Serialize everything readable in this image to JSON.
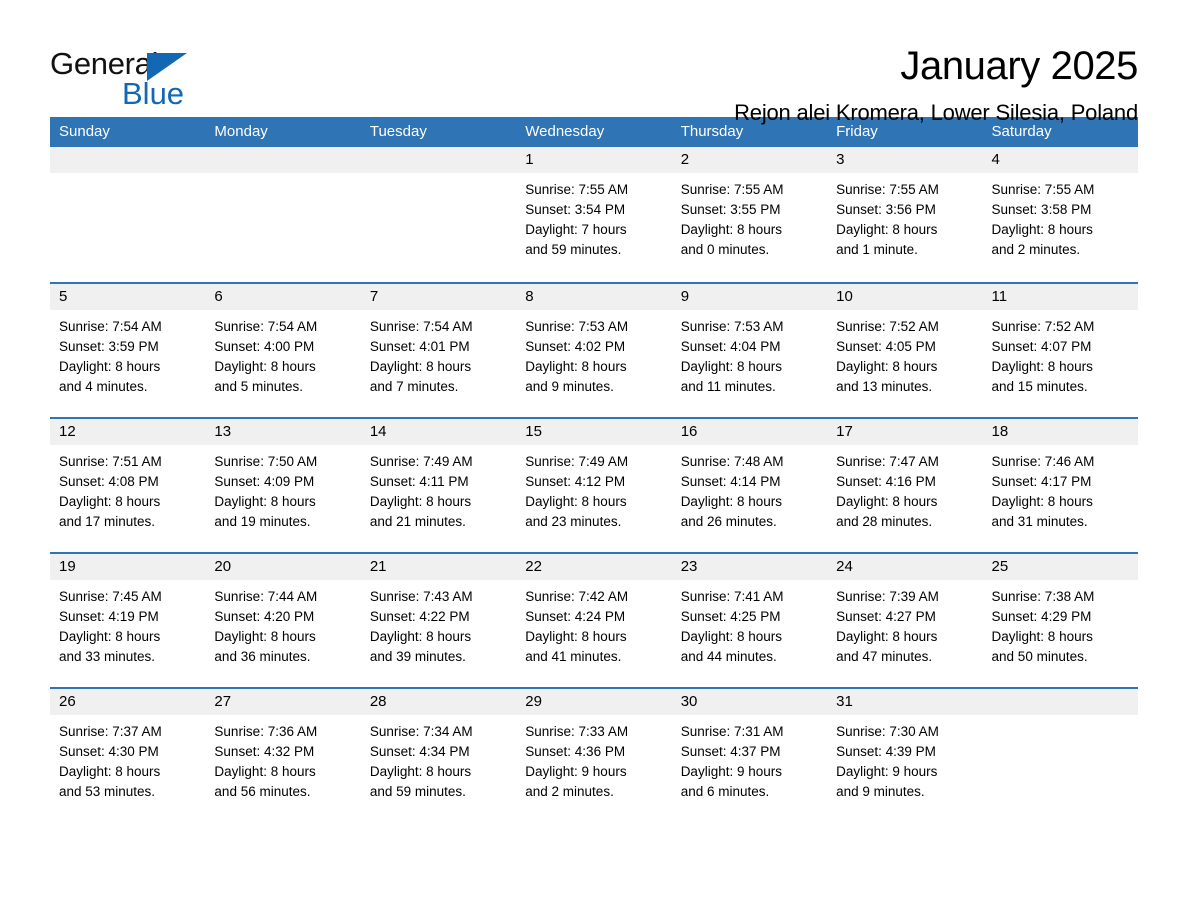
{
  "brand": {
    "name_part1": "General",
    "name_part2": "Blue",
    "triangle_color": "#1268b3"
  },
  "header": {
    "title": "January 2025",
    "subtitle": "Rejon alei Kromera, Lower Silesia, Poland",
    "accent_color": "#2f74b5",
    "day_band_color": "#f0f0f0"
  },
  "weekdays": [
    {
      "label": "Sunday"
    },
    {
      "label": "Monday"
    },
    {
      "label": "Tuesday"
    },
    {
      "label": "Wednesday"
    },
    {
      "label": "Thursday"
    },
    {
      "label": "Friday"
    },
    {
      "label": "Saturday"
    }
  ],
  "weeks": [
    [
      {
        "day": "",
        "sunrise": "",
        "sunset": "",
        "daylight_line1": "",
        "daylight_line2": ""
      },
      {
        "day": "",
        "sunrise": "",
        "sunset": "",
        "daylight_line1": "",
        "daylight_line2": ""
      },
      {
        "day": "",
        "sunrise": "",
        "sunset": "",
        "daylight_line1": "",
        "daylight_line2": ""
      },
      {
        "day": "1",
        "sunrise": "Sunrise: 7:55 AM",
        "sunset": "Sunset: 3:54 PM",
        "daylight_line1": "Daylight: 7 hours",
        "daylight_line2": "and 59 minutes."
      },
      {
        "day": "2",
        "sunrise": "Sunrise: 7:55 AM",
        "sunset": "Sunset: 3:55 PM",
        "daylight_line1": "Daylight: 8 hours",
        "daylight_line2": "and 0 minutes."
      },
      {
        "day": "3",
        "sunrise": "Sunrise: 7:55 AM",
        "sunset": "Sunset: 3:56 PM",
        "daylight_line1": "Daylight: 8 hours",
        "daylight_line2": "and 1 minute."
      },
      {
        "day": "4",
        "sunrise": "Sunrise: 7:55 AM",
        "sunset": "Sunset: 3:58 PM",
        "daylight_line1": "Daylight: 8 hours",
        "daylight_line2": "and 2 minutes."
      }
    ],
    [
      {
        "day": "5",
        "sunrise": "Sunrise: 7:54 AM",
        "sunset": "Sunset: 3:59 PM",
        "daylight_line1": "Daylight: 8 hours",
        "daylight_line2": "and 4 minutes."
      },
      {
        "day": "6",
        "sunrise": "Sunrise: 7:54 AM",
        "sunset": "Sunset: 4:00 PM",
        "daylight_line1": "Daylight: 8 hours",
        "daylight_line2": "and 5 minutes."
      },
      {
        "day": "7",
        "sunrise": "Sunrise: 7:54 AM",
        "sunset": "Sunset: 4:01 PM",
        "daylight_line1": "Daylight: 8 hours",
        "daylight_line2": "and 7 minutes."
      },
      {
        "day": "8",
        "sunrise": "Sunrise: 7:53 AM",
        "sunset": "Sunset: 4:02 PM",
        "daylight_line1": "Daylight: 8 hours",
        "daylight_line2": "and 9 minutes."
      },
      {
        "day": "9",
        "sunrise": "Sunrise: 7:53 AM",
        "sunset": "Sunset: 4:04 PM",
        "daylight_line1": "Daylight: 8 hours",
        "daylight_line2": "and 11 minutes."
      },
      {
        "day": "10",
        "sunrise": "Sunrise: 7:52 AM",
        "sunset": "Sunset: 4:05 PM",
        "daylight_line1": "Daylight: 8 hours",
        "daylight_line2": "and 13 minutes."
      },
      {
        "day": "11",
        "sunrise": "Sunrise: 7:52 AM",
        "sunset": "Sunset: 4:07 PM",
        "daylight_line1": "Daylight: 8 hours",
        "daylight_line2": "and 15 minutes."
      }
    ],
    [
      {
        "day": "12",
        "sunrise": "Sunrise: 7:51 AM",
        "sunset": "Sunset: 4:08 PM",
        "daylight_line1": "Daylight: 8 hours",
        "daylight_line2": "and 17 minutes."
      },
      {
        "day": "13",
        "sunrise": "Sunrise: 7:50 AM",
        "sunset": "Sunset: 4:09 PM",
        "daylight_line1": "Daylight: 8 hours",
        "daylight_line2": "and 19 minutes."
      },
      {
        "day": "14",
        "sunrise": "Sunrise: 7:49 AM",
        "sunset": "Sunset: 4:11 PM",
        "daylight_line1": "Daylight: 8 hours",
        "daylight_line2": "and 21 minutes."
      },
      {
        "day": "15",
        "sunrise": "Sunrise: 7:49 AM",
        "sunset": "Sunset: 4:12 PM",
        "daylight_line1": "Daylight: 8 hours",
        "daylight_line2": "and 23 minutes."
      },
      {
        "day": "16",
        "sunrise": "Sunrise: 7:48 AM",
        "sunset": "Sunset: 4:14 PM",
        "daylight_line1": "Daylight: 8 hours",
        "daylight_line2": "and 26 minutes."
      },
      {
        "day": "17",
        "sunrise": "Sunrise: 7:47 AM",
        "sunset": "Sunset: 4:16 PM",
        "daylight_line1": "Daylight: 8 hours",
        "daylight_line2": "and 28 minutes."
      },
      {
        "day": "18",
        "sunrise": "Sunrise: 7:46 AM",
        "sunset": "Sunset: 4:17 PM",
        "daylight_line1": "Daylight: 8 hours",
        "daylight_line2": "and 31 minutes."
      }
    ],
    [
      {
        "day": "19",
        "sunrise": "Sunrise: 7:45 AM",
        "sunset": "Sunset: 4:19 PM",
        "daylight_line1": "Daylight: 8 hours",
        "daylight_line2": "and 33 minutes."
      },
      {
        "day": "20",
        "sunrise": "Sunrise: 7:44 AM",
        "sunset": "Sunset: 4:20 PM",
        "daylight_line1": "Daylight: 8 hours",
        "daylight_line2": "and 36 minutes."
      },
      {
        "day": "21",
        "sunrise": "Sunrise: 7:43 AM",
        "sunset": "Sunset: 4:22 PM",
        "daylight_line1": "Daylight: 8 hours",
        "daylight_line2": "and 39 minutes."
      },
      {
        "day": "22",
        "sunrise": "Sunrise: 7:42 AM",
        "sunset": "Sunset: 4:24 PM",
        "daylight_line1": "Daylight: 8 hours",
        "daylight_line2": "and 41 minutes."
      },
      {
        "day": "23",
        "sunrise": "Sunrise: 7:41 AM",
        "sunset": "Sunset: 4:25 PM",
        "daylight_line1": "Daylight: 8 hours",
        "daylight_line2": "and 44 minutes."
      },
      {
        "day": "24",
        "sunrise": "Sunrise: 7:39 AM",
        "sunset": "Sunset: 4:27 PM",
        "daylight_line1": "Daylight: 8 hours",
        "daylight_line2": "and 47 minutes."
      },
      {
        "day": "25",
        "sunrise": "Sunrise: 7:38 AM",
        "sunset": "Sunset: 4:29 PM",
        "daylight_line1": "Daylight: 8 hours",
        "daylight_line2": "and 50 minutes."
      }
    ],
    [
      {
        "day": "26",
        "sunrise": "Sunrise: 7:37 AM",
        "sunset": "Sunset: 4:30 PM",
        "daylight_line1": "Daylight: 8 hours",
        "daylight_line2": "and 53 minutes."
      },
      {
        "day": "27",
        "sunrise": "Sunrise: 7:36 AM",
        "sunset": "Sunset: 4:32 PM",
        "daylight_line1": "Daylight: 8 hours",
        "daylight_line2": "and 56 minutes."
      },
      {
        "day": "28",
        "sunrise": "Sunrise: 7:34 AM",
        "sunset": "Sunset: 4:34 PM",
        "daylight_line1": "Daylight: 8 hours",
        "daylight_line2": "and 59 minutes."
      },
      {
        "day": "29",
        "sunrise": "Sunrise: 7:33 AM",
        "sunset": "Sunset: 4:36 PM",
        "daylight_line1": "Daylight: 9 hours",
        "daylight_line2": "and 2 minutes."
      },
      {
        "day": "30",
        "sunrise": "Sunrise: 7:31 AM",
        "sunset": "Sunset: 4:37 PM",
        "daylight_line1": "Daylight: 9 hours",
        "daylight_line2": "and 6 minutes."
      },
      {
        "day": "31",
        "sunrise": "Sunrise: 7:30 AM",
        "sunset": "Sunset: 4:39 PM",
        "daylight_line1": "Daylight: 9 hours",
        "daylight_line2": "and 9 minutes."
      },
      {
        "day": "",
        "sunrise": "",
        "sunset": "",
        "daylight_line1": "",
        "daylight_line2": ""
      }
    ]
  ]
}
